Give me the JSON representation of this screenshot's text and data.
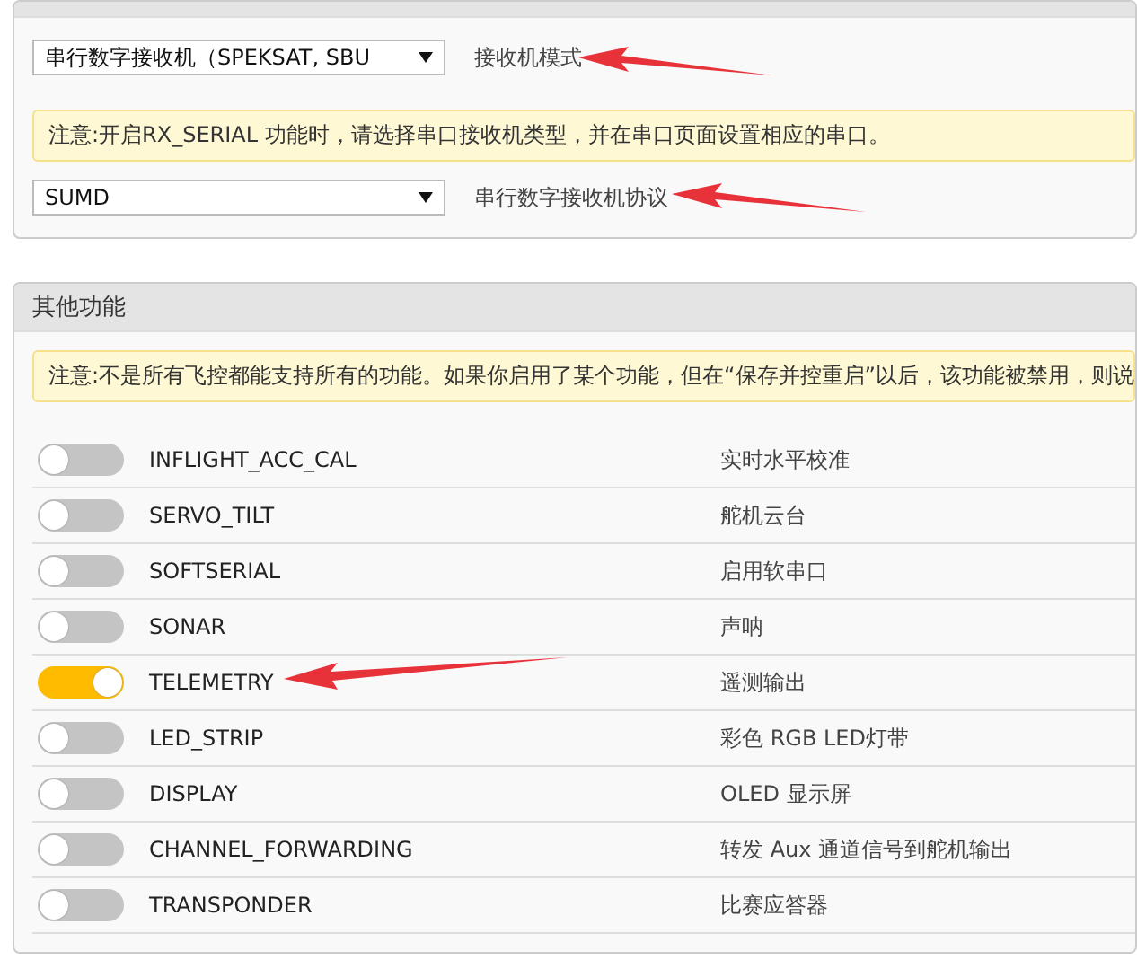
{
  "receiver_panel": {
    "mode_select": {
      "value": "串行数字接收机（SPEKSAT, SBU"
    },
    "mode_label": "接收机模式",
    "note": "注意:开启RX_SERIAL 功能时，请选择串口接收机类型，并在串口页面设置相应的串口。",
    "provider_select": {
      "value": "SUMD"
    },
    "provider_label": "串行数字接收机协议"
  },
  "other_features_panel": {
    "title": "其他功能",
    "note": "注意:不是所有飞控都能支持所有的功能。如果你启用了某个功能，但在“保存并控重启”以后，该功能被禁用，则说",
    "features": [
      {
        "name": "INFLIGHT_ACC_CAL",
        "description": "实时水平校准",
        "enabled": false
      },
      {
        "name": "SERVO_TILT",
        "description": "舵机云台",
        "enabled": false
      },
      {
        "name": "SOFTSERIAL",
        "description": "启用软串口",
        "enabled": false
      },
      {
        "name": "SONAR",
        "description": "声呐",
        "enabled": false
      },
      {
        "name": "TELEMETRY",
        "description": "遥测输出",
        "enabled": true
      },
      {
        "name": "LED_STRIP",
        "description": "彩色 RGB LED灯带",
        "enabled": false
      },
      {
        "name": "DISPLAY",
        "description": "OLED 显示屏",
        "enabled": false
      },
      {
        "name": "CHANNEL_FORWARDING",
        "description": "转发 Aux 通道信号到舵机输出",
        "enabled": false
      },
      {
        "name": "TRANSPONDER",
        "description": "比赛应答器",
        "enabled": false
      }
    ]
  }
}
